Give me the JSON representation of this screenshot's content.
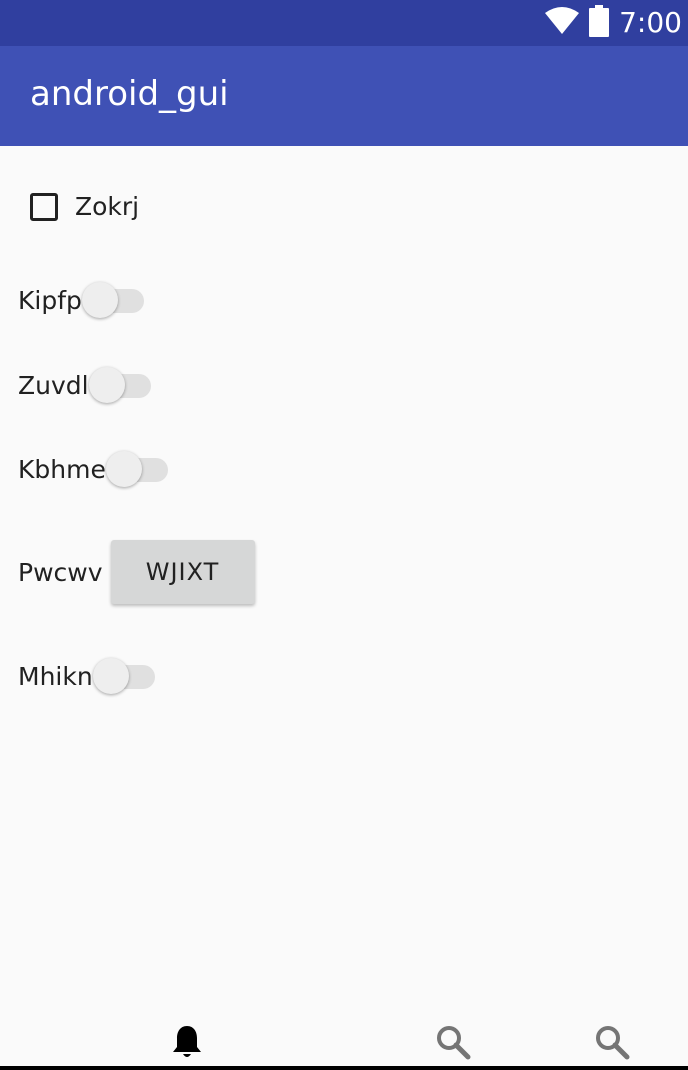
{
  "status_bar": {
    "time": "7:00",
    "icons": [
      "wifi-icon",
      "battery-icon"
    ]
  },
  "app_bar": {
    "title": "android_gui"
  },
  "checkbox": {
    "label": "Zokrj",
    "checked": false
  },
  "switches": [
    {
      "label": "Kipfp",
      "on": false
    },
    {
      "label": "Zuvdl",
      "on": false
    },
    {
      "label": "Kbhme",
      "on": false
    },
    {
      "label": "Mhikn",
      "on": false
    }
  ],
  "button_row": {
    "label": "Pwcwv",
    "button_label": "WJIXT"
  },
  "bottom_nav": {
    "items": [
      "bell-icon",
      "search-icon",
      "search-icon"
    ],
    "colors": {
      "active": "#000000",
      "inactive": "#757575"
    }
  },
  "colors": {
    "status_bar": "#303f9f",
    "app_bar": "#3f51b5",
    "background": "#fafafa"
  }
}
